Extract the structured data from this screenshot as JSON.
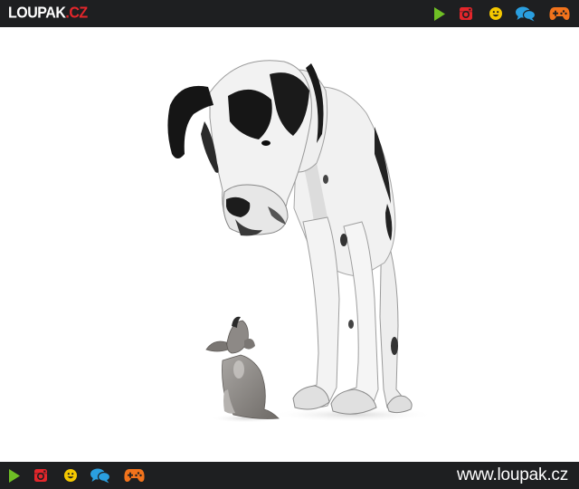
{
  "header": {
    "logo_main": "LOUPAK",
    "logo_tld": ".CZ",
    "icons": [
      "play-icon",
      "instagram-icon",
      "smiley-icon",
      "chat-bubbles-icon",
      "gamepad-icon"
    ]
  },
  "photo": {
    "subject": [
      "great-dane",
      "chihuahua-puppy"
    ]
  },
  "footer": {
    "icons": [
      "play-icon",
      "instagram-icon",
      "smiley-icon",
      "chat-bubbles-icon",
      "gamepad-icon"
    ],
    "site_url": "www.loupak.cz"
  },
  "colors": {
    "bar_bg": "#1e1f21",
    "play": "#6fbf25",
    "instagram": "#e3262b",
    "smiley": "#f5c800",
    "chat": "#2a9fe0",
    "gamepad": "#f2731c",
    "logo_accent": "#e3262b"
  }
}
